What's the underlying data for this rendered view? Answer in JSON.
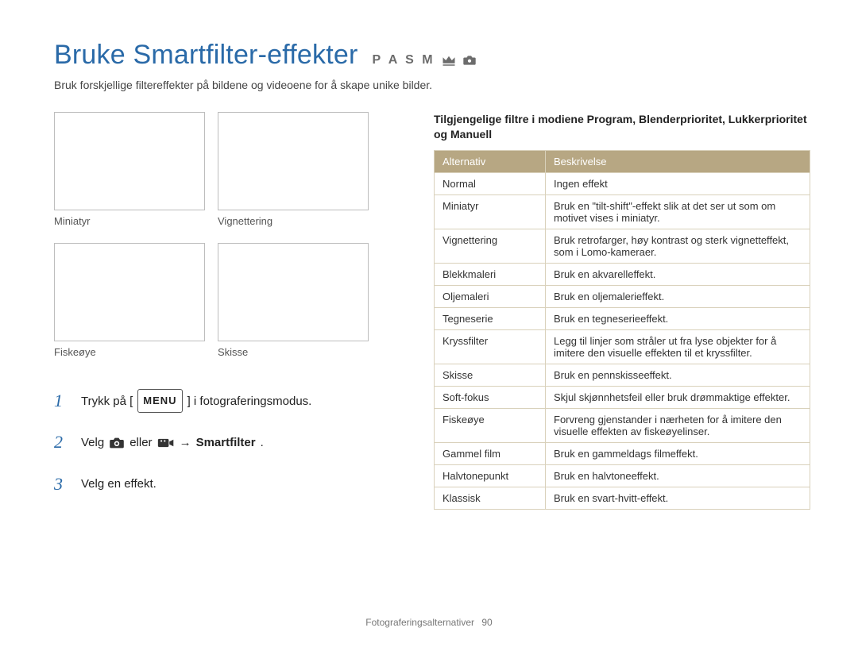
{
  "title": "Bruke Smartfilter-effekter",
  "modes_text": "P A S M",
  "intro": "Bruk forskjellige filtereffekter på bildene og videoene for å skape unike bilder.",
  "thumbs": {
    "r1c1": "Miniatyr",
    "r1c2": "Vignettering",
    "r2c1": "Fiskeøye",
    "r2c2": "Skisse"
  },
  "steps": {
    "s1_a": "Trykk på [",
    "s1_menu": "MENU",
    "s1_b": "] i fotograferingsmodus.",
    "s2_a": "Velg",
    "s2_b": "eller",
    "s2_c": "→",
    "s2_d": "Smartfilter",
    "s2_e": ".",
    "s3": "Velg en effekt."
  },
  "right_heading": "Tilgjengelige filtre i modiene Program, Blenderprioritet, Lukkerprioritet og Manuell",
  "table": {
    "head_alt": "Alternativ",
    "head_desc": "Beskrivelse",
    "rows": [
      {
        "alt": "Normal",
        "desc": "Ingen effekt"
      },
      {
        "alt": "Miniatyr",
        "desc": "Bruk en \"tilt-shift\"-effekt slik at det ser ut som om motivet vises i miniatyr."
      },
      {
        "alt": "Vignettering",
        "desc": "Bruk retrofarger, høy kontrast og sterk vignetteffekt, som i Lomo-kameraer."
      },
      {
        "alt": "Blekkmaleri",
        "desc": "Bruk en akvarelleffekt."
      },
      {
        "alt": "Oljemaleri",
        "desc": "Bruk en oljemalerieffekt."
      },
      {
        "alt": "Tegneserie",
        "desc": "Bruk en tegneserieeffekt."
      },
      {
        "alt": "Kryssfilter",
        "desc": "Legg til linjer som stråler ut fra lyse objekter for å imitere den visuelle effekten til et kryssfilter."
      },
      {
        "alt": "Skisse",
        "desc": "Bruk en pennskisseeffekt."
      },
      {
        "alt": "Soft-fokus",
        "desc": "Skjul skjønnhetsfeil eller bruk drømmaktige effekter."
      },
      {
        "alt": "Fiskeøye",
        "desc": "Forvreng gjenstander i nærheten for å imitere den visuelle effekten av fiskeøyelinser."
      },
      {
        "alt": "Gammel film",
        "desc": "Bruk en gammeldags filmeffekt."
      },
      {
        "alt": "Halvtonepunkt",
        "desc": "Bruk en halvtoneeffekt."
      },
      {
        "alt": "Klassisk",
        "desc": "Bruk en svart-hvitt-effekt."
      }
    ]
  },
  "footer": {
    "section": "Fotograferingsalternativer",
    "page": "90"
  }
}
